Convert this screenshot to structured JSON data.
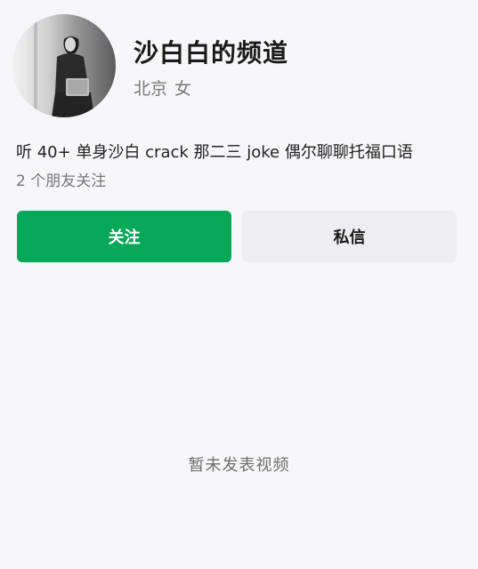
{
  "profile": {
    "name": "沙白白的频道",
    "location": "北京",
    "gender": "女",
    "bio": "听 40+ 单身沙白 crack 那二三 joke 偶尔聊聊托福口语",
    "friends_following": "2 个朋友关注"
  },
  "actions": {
    "follow_label": "关注",
    "message_label": "私信"
  },
  "content": {
    "empty_state": "暂未发表视频"
  },
  "colors": {
    "follow_button": "#07a759",
    "message_button": "#eeeef1",
    "background": "#f7f7f9"
  }
}
